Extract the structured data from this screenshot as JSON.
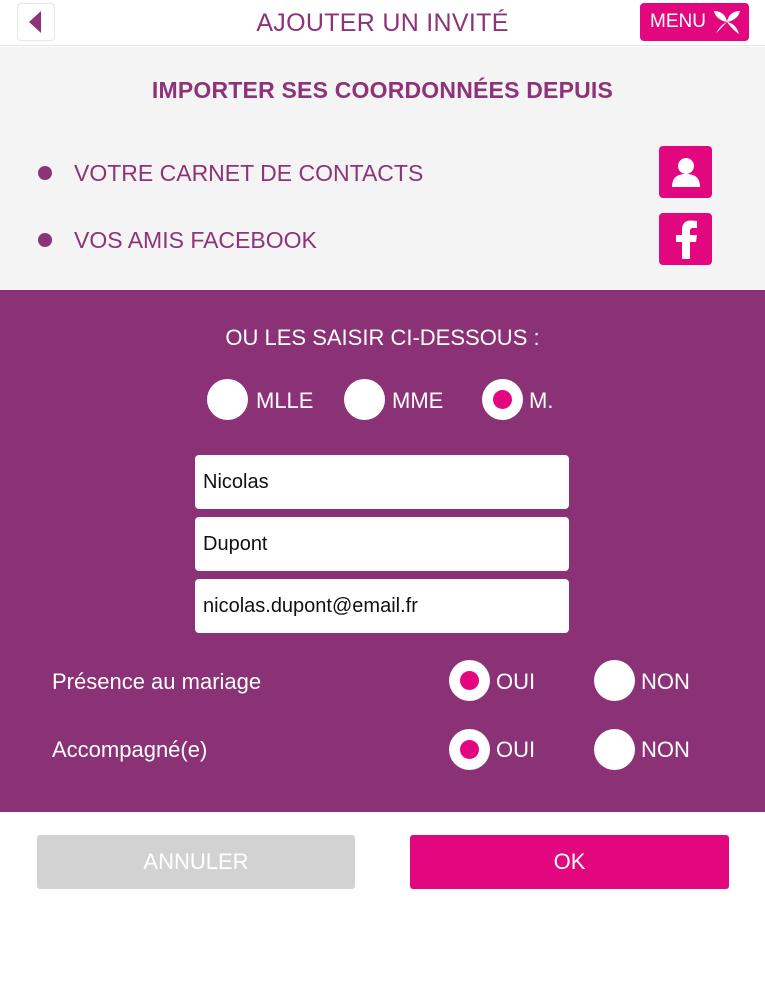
{
  "header": {
    "title": "AJOUTER UN INVITÉ",
    "menu_label": "MENU"
  },
  "import": {
    "title": "IMPORTER SES COORDONNÉES DEPUIS",
    "items": [
      {
        "label": "VOTRE CARNET DE CONTACTS",
        "icon": "contact-icon"
      },
      {
        "label": "VOS AMIS FACEBOOK",
        "icon": "facebook-icon"
      }
    ]
  },
  "form": {
    "title": "OU LES SAISIR CI-DESSOUS :",
    "civility": {
      "options": [
        "MLLE",
        "MME",
        "M."
      ],
      "selected": "M."
    },
    "first_name": "Nicolas",
    "last_name": "Dupont",
    "email": "nicolas.dupont@email.fr",
    "presence": {
      "label": "Présence au mariage",
      "yes": "OUI",
      "no": "NON",
      "selected": "OUI"
    },
    "accompanied": {
      "label": "Accompagné(e)",
      "yes": "OUI",
      "no": "NON",
      "selected": "OUI"
    }
  },
  "actions": {
    "cancel_label": "ANNULER",
    "ok_label": "OK"
  },
  "colors": {
    "accent": "#e2077f",
    "brand_purple": "#8b3175",
    "light_bg": "#f4f4f5"
  }
}
